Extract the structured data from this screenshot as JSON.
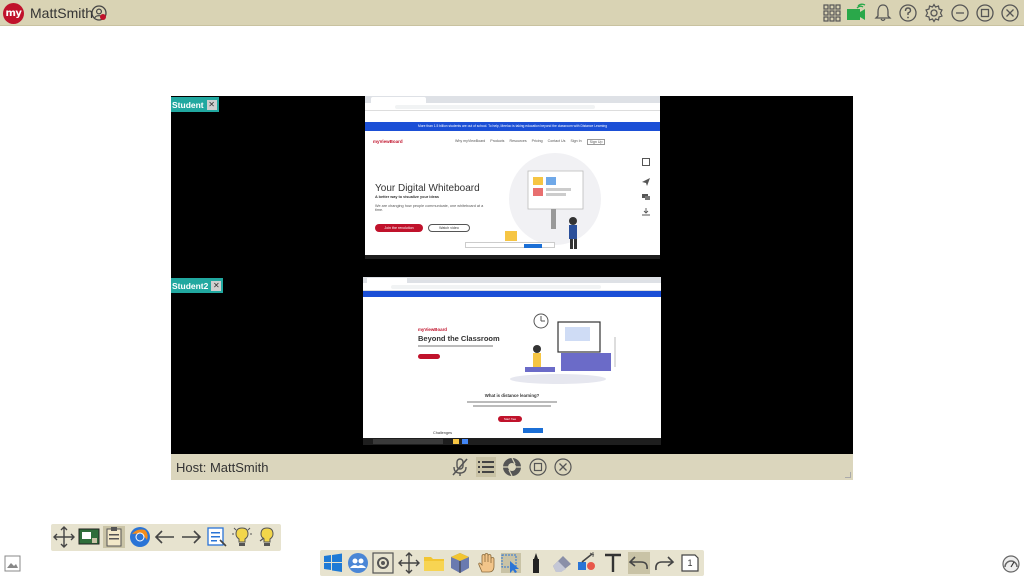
{
  "app": {
    "logo_text": "my",
    "user_name": "MattSmith"
  },
  "titlebar_icons": [
    "apps-grid-icon",
    "camera-icon",
    "bell-icon",
    "help-icon",
    "gear-icon",
    "minimize-icon",
    "maximize-icon",
    "close-icon"
  ],
  "streams": [
    {
      "tag": "Student",
      "page": {
        "notice": "More than 1.5 billion students are out of school. To help, Meeloo is taking education beyond the classroom with Distance Learning",
        "brand": "myViewBoard",
        "nav": [
          "Why myViewBoard",
          "Products",
          "Resources",
          "Pricing",
          "Contact Us",
          "Sign In",
          "Sign Up"
        ],
        "headline": "Your Digital Whiteboard",
        "subline": "A better way to visualize your ideas",
        "body": "We are changing how people communicate, one whiteboard at a time.",
        "cta_primary": "Join the revolution",
        "cta_secondary": "Watch video"
      }
    },
    {
      "tag": "Student2",
      "page": {
        "brand": "myViewBoard",
        "headline": "Beyond the Classroom",
        "section_title": "What is distance learning?",
        "cta_primary": "Start free",
        "cta_secondary": "Learn more",
        "footer_text": "Challenges"
      }
    }
  ],
  "host": {
    "label": "Host: MattSmith"
  },
  "host_controls": [
    "mute-mic-icon",
    "list-icon",
    "camera-shutter-icon",
    "window-icon",
    "close-circle-icon"
  ],
  "toolbar_left": [
    "move-icon",
    "screen-share-icon",
    "clipboard-icon",
    "browser-icon",
    "arrow-left-icon",
    "arrow-right-icon",
    "notes-icon",
    "bulb-icon",
    "bulb-alt-icon"
  ],
  "toolbar_bottom": [
    "windows-icon",
    "people-icon",
    "settings-cog-icon",
    "move-tool-icon",
    "folder-icon",
    "toolbox-icon",
    "hand-icon",
    "select-icon",
    "pen-icon",
    "eraser-icon",
    "magic-icon",
    "text-icon",
    "undo-icon",
    "redo-icon",
    "page-icon"
  ],
  "page_number": "1",
  "colors": {
    "titlebar": "#d9d3b4",
    "accent_red": "#c0122b",
    "stream_tag": "#21a8a0",
    "toolbar": "#e7e3cf"
  }
}
